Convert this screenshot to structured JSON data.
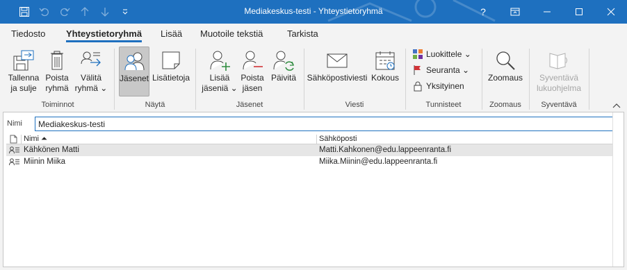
{
  "window": {
    "title": "Mediakeskus-testi  -  Yhteystietoryhmä",
    "help_label": "?",
    "accent": "#1e70bf"
  },
  "qat": {
    "icons": [
      "save-icon",
      "undo-icon",
      "redo-icon",
      "up-icon",
      "down-icon",
      "customize-qat-icon"
    ]
  },
  "tabs": [
    {
      "label": "Tiedosto"
    },
    {
      "label": "Yhteystietoryhmä"
    },
    {
      "label": "Lisää"
    },
    {
      "label": "Muotoile tekstiä"
    },
    {
      "label": "Tarkista"
    }
  ],
  "ribbon": {
    "toiminnot": {
      "label": "Toiminnot",
      "save_close_1": "Tallenna",
      "save_close_2": "ja sulje",
      "delete_1": "Poista",
      "delete_2": "ryhmä",
      "forward_1": "Välitä",
      "forward_2": "ryhmä ⌄"
    },
    "nayta": {
      "label": "Näytä",
      "members": "Jäsenet",
      "notes": "Lisätietoja"
    },
    "jasenet": {
      "label": "Jäsenet",
      "add_1": "Lisää",
      "add_2": "jäseniä ⌄",
      "remove_1": "Poista",
      "remove_2": "jäsen",
      "update": "Päivitä"
    },
    "viesti": {
      "label": "Viesti",
      "email": "Sähköpostiviesti",
      "meeting": "Kokous"
    },
    "tunnisteet": {
      "label": "Tunnisteet",
      "categorize": "Luokittele ⌄",
      "followup": "Seuranta ⌄",
      "private": "Yksityinen"
    },
    "zoomaus": {
      "label": "Zoomaus",
      "zoom": "Zoomaus"
    },
    "syventava": {
      "label": "Syventävä",
      "reader_1": "Syventävä",
      "reader_2": "lukuohjelma"
    }
  },
  "form": {
    "name_label": "Nimi",
    "name_value": "Mediakeskus-testi"
  },
  "members_table": {
    "columns": [
      "Nimi ⏶",
      "Sähköposti"
    ],
    "rows": [
      {
        "name": "Kähkönen Matti",
        "email": "Matti.Kahkonen@edu.lappeenranta.fi",
        "selected": true
      },
      {
        "name": "Miinin Miika",
        "email": "Miika.Miinin@edu.lappeenranta.fi",
        "selected": false
      }
    ]
  }
}
